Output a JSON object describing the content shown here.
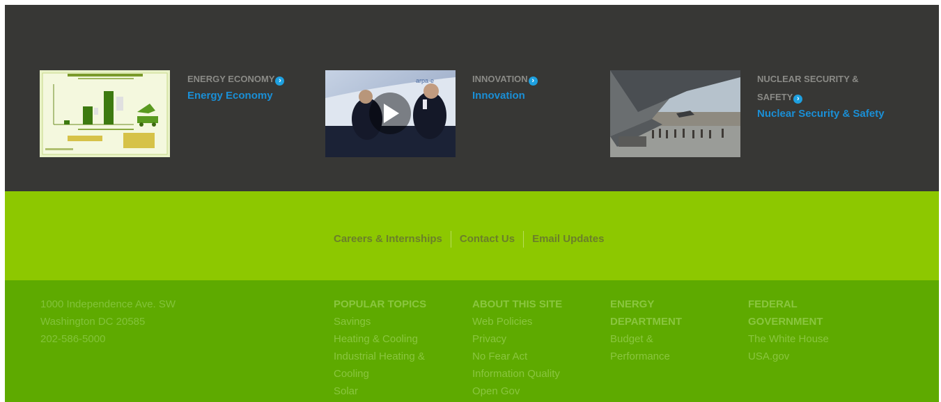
{
  "featured": [
    {
      "kicker": "ENERGY ECONOMY",
      "title": "Energy Economy"
    },
    {
      "kicker": "INNOVATION",
      "title": "Innovation"
    },
    {
      "kicker_line1": "NUCLEAR SECURITY &",
      "kicker_line2": "SAFETY",
      "title": "Nuclear Security & Safety"
    }
  ],
  "links": [
    "Careers & Internships",
    "Contact Us",
    "Email Updates"
  ],
  "address": [
    "1000 Independence Ave. SW",
    "Washington DC 20585",
    "202-586-5000"
  ],
  "columns": [
    {
      "heading": [
        "POPULAR TOPICS"
      ],
      "items": [
        "Savings",
        "Heating & Cooling",
        "Industrial Heating &",
        "Cooling",
        "Solar"
      ]
    },
    {
      "heading": [
        "ABOUT THIS SITE"
      ],
      "items": [
        "Web Policies",
        "Privacy",
        "No Fear Act",
        "Information Quality",
        "Open Gov"
      ]
    },
    {
      "heading": [
        "ENERGY",
        "DEPARTMENT"
      ],
      "items": [
        "Budget &",
        "Performance"
      ]
    },
    {
      "heading": [
        "FEDERAL",
        "GOVERNMENT"
      ],
      "items": [
        "The White House",
        "USA.gov"
      ]
    }
  ],
  "colors": {
    "dark_bg": "#373735",
    "link_blue": "#1a8fd6",
    "bar_green": "#8dc800",
    "footer_green": "#5eaa00"
  }
}
